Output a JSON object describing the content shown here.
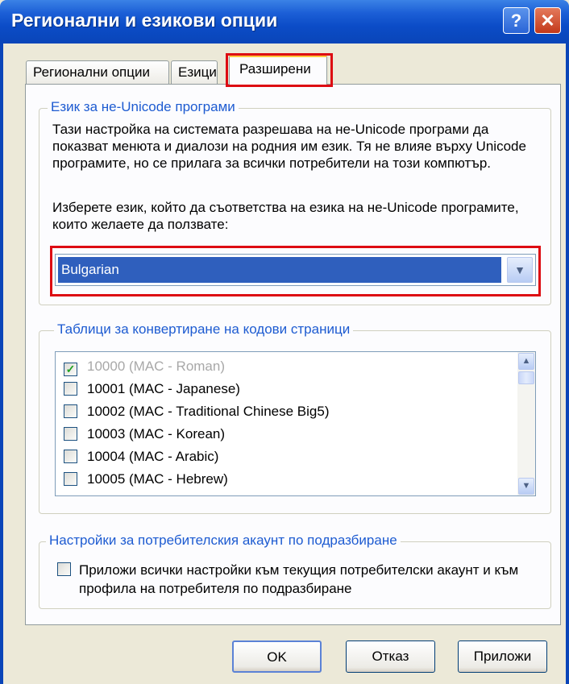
{
  "window": {
    "title": "Регионални и езикови опции",
    "help_label": "?",
    "close_label": "✕"
  },
  "tabs": [
    {
      "label": "Регионални опции"
    },
    {
      "label": "Езици"
    },
    {
      "label": "Разширени",
      "selected": true
    }
  ],
  "non_unicode": {
    "legend": "Език за не-Unicode програми",
    "description": "Тази настройка на системата разрешава на не-Unicode програми да показват менюта и диалози на родния им език. Тя не влияе върху Unicode програмите, но се прилага за всички потребители на този компютър.",
    "prompt": "Изберете език, който да съответства на езика на не-Unicode програмите, които желаете да ползвате:",
    "selected_language": "Bulgarian",
    "arrow_icon": "chevron-down-icon"
  },
  "code_pages": {
    "legend": "Таблици за конвертиране на кодови страници",
    "items": [
      {
        "label": "10000 (MAC - Roman)",
        "checked": true,
        "disabled": true
      },
      {
        "label": "10001 (MAC - Japanese)",
        "checked": false,
        "disabled": false
      },
      {
        "label": "10002 (MAC - Traditional Chinese Big5)",
        "checked": false,
        "disabled": false
      },
      {
        "label": "10003 (MAC - Korean)",
        "checked": false,
        "disabled": false
      },
      {
        "label": "10004 (MAC - Arabic)",
        "checked": false,
        "disabled": false
      },
      {
        "label": "10005 (MAC - Hebrew)",
        "checked": false,
        "disabled": false
      }
    ]
  },
  "default_account": {
    "legend": "Настройки за потребителския акаунт по подразбиране",
    "checkbox_label": "Приложи всички настройки към текущия потребителски акаунт и към профила на потребителя по подразбиране",
    "checked": false
  },
  "buttons": {
    "ok": "OK",
    "cancel": "Отказ",
    "apply": "Приложи"
  },
  "colors": {
    "titlebar": "#0a45b8",
    "highlight": "#dd0b12",
    "selection": "#2f5fbd",
    "legend_text": "#1d5bd1"
  }
}
